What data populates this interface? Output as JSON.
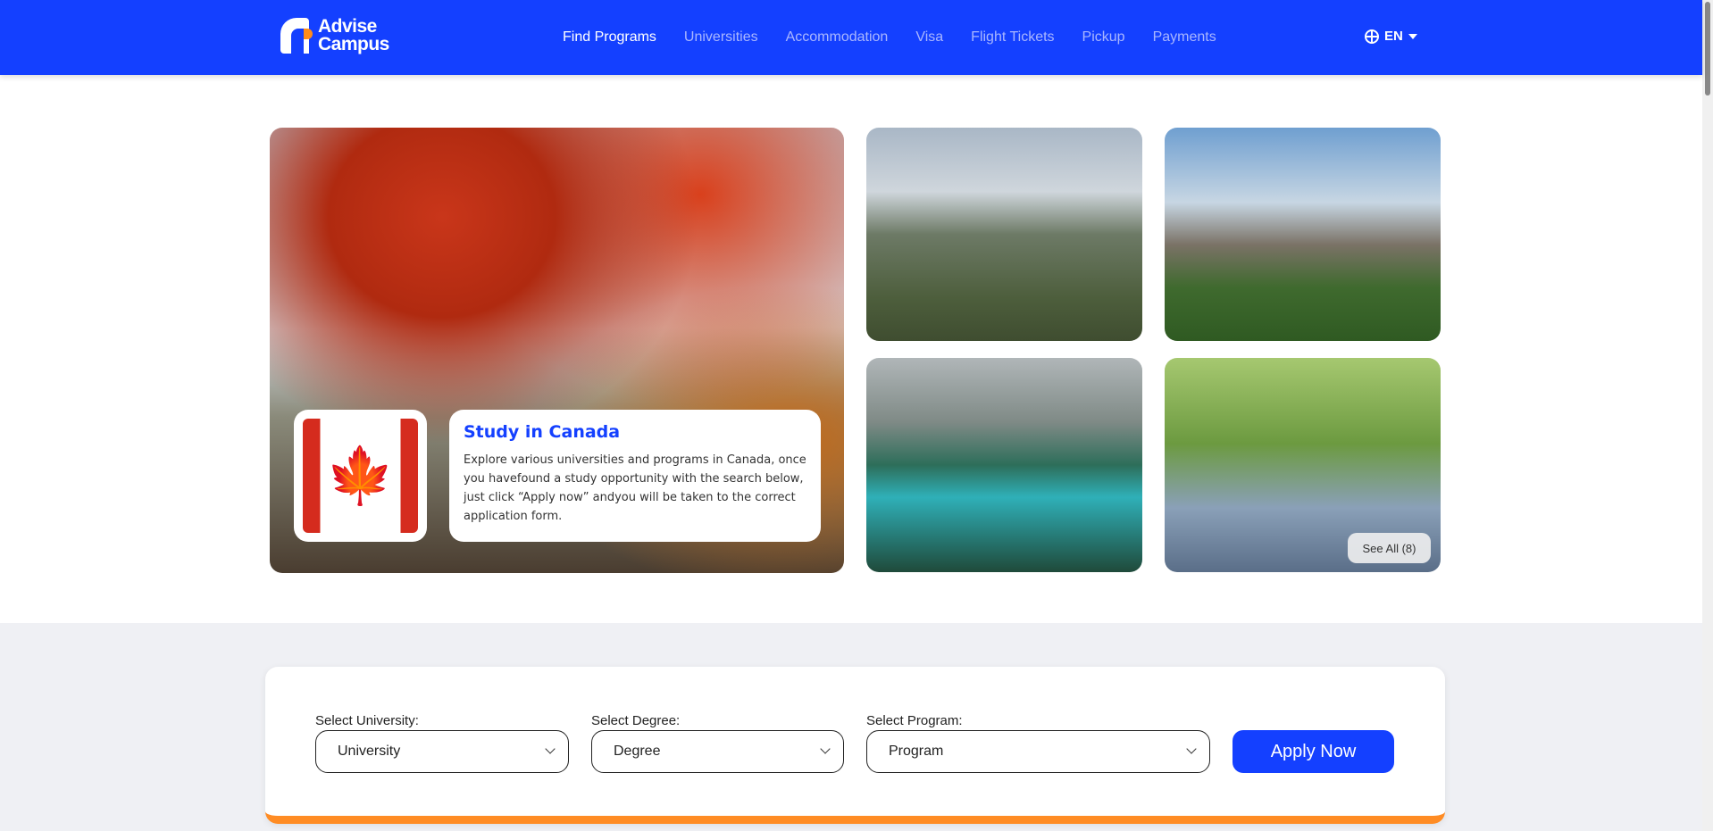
{
  "header": {
    "logo_line1": "Advise",
    "logo_line2": "Campus",
    "nav": [
      {
        "label": "Find Programs",
        "active": true
      },
      {
        "label": "Universities"
      },
      {
        "label": "Accommodation"
      },
      {
        "label": "Visa"
      },
      {
        "label": "Flight Tickets"
      },
      {
        "label": "Pickup"
      },
      {
        "label": "Payments"
      }
    ],
    "language": "EN",
    "accent": "#1440ff"
  },
  "hero": {
    "title": "Study in Canada",
    "description": "Explore various universities and programs in Canada, once you havefound a study opportunity with the search below, just click “Apply now” andyou will be taken to the correct application form.",
    "flag_glyph": "🍁",
    "see_all": "See All (8)"
  },
  "search": {
    "university_label": "Select University:",
    "university_value": "University",
    "degree_label": "Select Degree:",
    "degree_value": "Degree",
    "program_label": "Select Program:",
    "program_value": "Program",
    "apply": "Apply Now",
    "accent_bottom": "#ff8c24"
  }
}
